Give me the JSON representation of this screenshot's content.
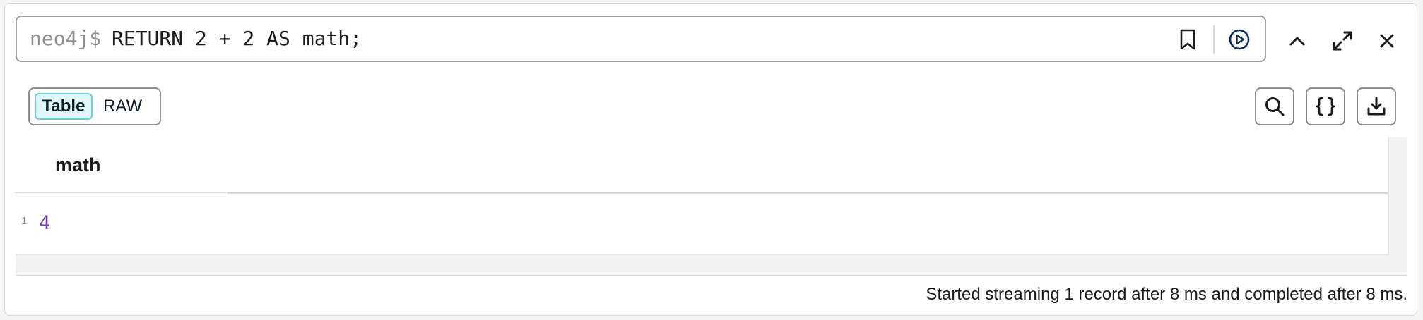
{
  "editor": {
    "prompt": "neo4j$",
    "query": "RETURN 2 + 2 AS math;"
  },
  "toolbar": {
    "icons": [
      "bookmark-icon",
      "run-icon",
      "collapse-icon",
      "fullscreen-icon",
      "close-icon"
    ]
  },
  "view": {
    "tabs": [
      {
        "label": "Table",
        "active": true
      },
      {
        "label": "RAW",
        "active": false
      }
    ],
    "actions": [
      "search-icon",
      "json-icon",
      "download-icon"
    ]
  },
  "table": {
    "columns": [
      "math"
    ],
    "rows": [
      {
        "index": "1",
        "values": [
          "4"
        ]
      }
    ]
  },
  "status": "Started streaming 1 record after 8 ms and completed after 8 ms.",
  "colors": {
    "accent": "#018bff",
    "active_tab_bg": "#dff6f8",
    "active_tab_border": "#70ccd6",
    "number_value": "#7b3fa6"
  }
}
